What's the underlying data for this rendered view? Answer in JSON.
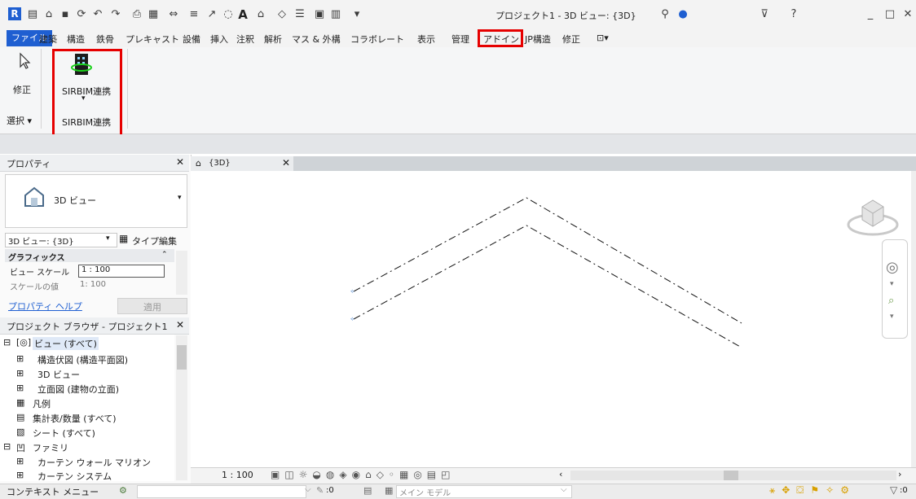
{
  "titlebar": {
    "title": "プロジェクト1 - 3D ビュー: {3D}",
    "app_logo": "R",
    "quick_access_icons": [
      "open-icon",
      "save-icon",
      "sync-icon",
      "undo-icon",
      "redo-icon",
      "print-icon",
      "pdf-icon",
      "measure-icon",
      "align-icon",
      "dimension-icon",
      "text-icon",
      "default-3d-icon",
      "tag-icon",
      "thin-lines-icon",
      "close-hidden-icon",
      "switch-windows-icon"
    ],
    "right_icons": [
      "binoculars-icon",
      "user-icon",
      "cart-icon",
      "help-icon"
    ],
    "window_controls": [
      "minimize-icon",
      "maximize-icon",
      "close-icon"
    ]
  },
  "menu": {
    "file": "ファイル",
    "items": [
      "建築",
      "構造",
      "鉄骨",
      "プレキャスト",
      "設備",
      "挿入",
      "注釈",
      "解析",
      "マス & 外構",
      "コラボレート",
      "表示",
      "管理",
      "アドイン",
      "JP構造",
      "修正"
    ],
    "highlighted": "アドイン",
    "accent_color": "#1f5fd1",
    "highlight_color": "#e60000"
  },
  "ribbon": {
    "modify_label": "修正",
    "select_label": "選択 ▾",
    "sirbim_button_label": "SIRBIM連携",
    "sirbim_panel_label": "SIRBIM連携"
  },
  "properties": {
    "title": "プロパティ",
    "type_name": "3D ビュー",
    "selector_value": "3D ビュー: {3D}",
    "type_edit_label": "タイプ編集",
    "section_graphics": "グラフィックス",
    "rows": [
      {
        "label": "ビュー スケール",
        "value": "1 : 100"
      },
      {
        "label": "スケールの値",
        "value": "1:  100"
      }
    ],
    "help_link": "プロパティ ヘルプ",
    "apply_label": "適用"
  },
  "browser": {
    "title": "プロジェクト ブラウザ - プロジェクト1",
    "items": [
      {
        "label": "ビュー (すべて)",
        "level": 0
      },
      {
        "label": "構造伏図 (構造平面図)",
        "level": 1
      },
      {
        "label": "3D ビュー",
        "level": 1
      },
      {
        "label": "立面図 (建物の立面)",
        "level": 1
      },
      {
        "label": "凡例",
        "level": 0
      },
      {
        "label": "集計表/数量 (すべて)",
        "level": 0
      },
      {
        "label": "シート (すべて)",
        "level": 0
      },
      {
        "label": "ファミリ",
        "level": 0
      },
      {
        "label": "カーテン ウォール マリオン",
        "level": 1
      },
      {
        "label": "カーテン システム",
        "level": 1
      }
    ]
  },
  "view": {
    "tab_label": "{3D}",
    "scale": "1 : 100"
  },
  "statusbar": {
    "context_menu": "コンテキスト メニュー",
    "count": ":0",
    "model": "メイン モデル",
    "filter_count": ":0"
  }
}
